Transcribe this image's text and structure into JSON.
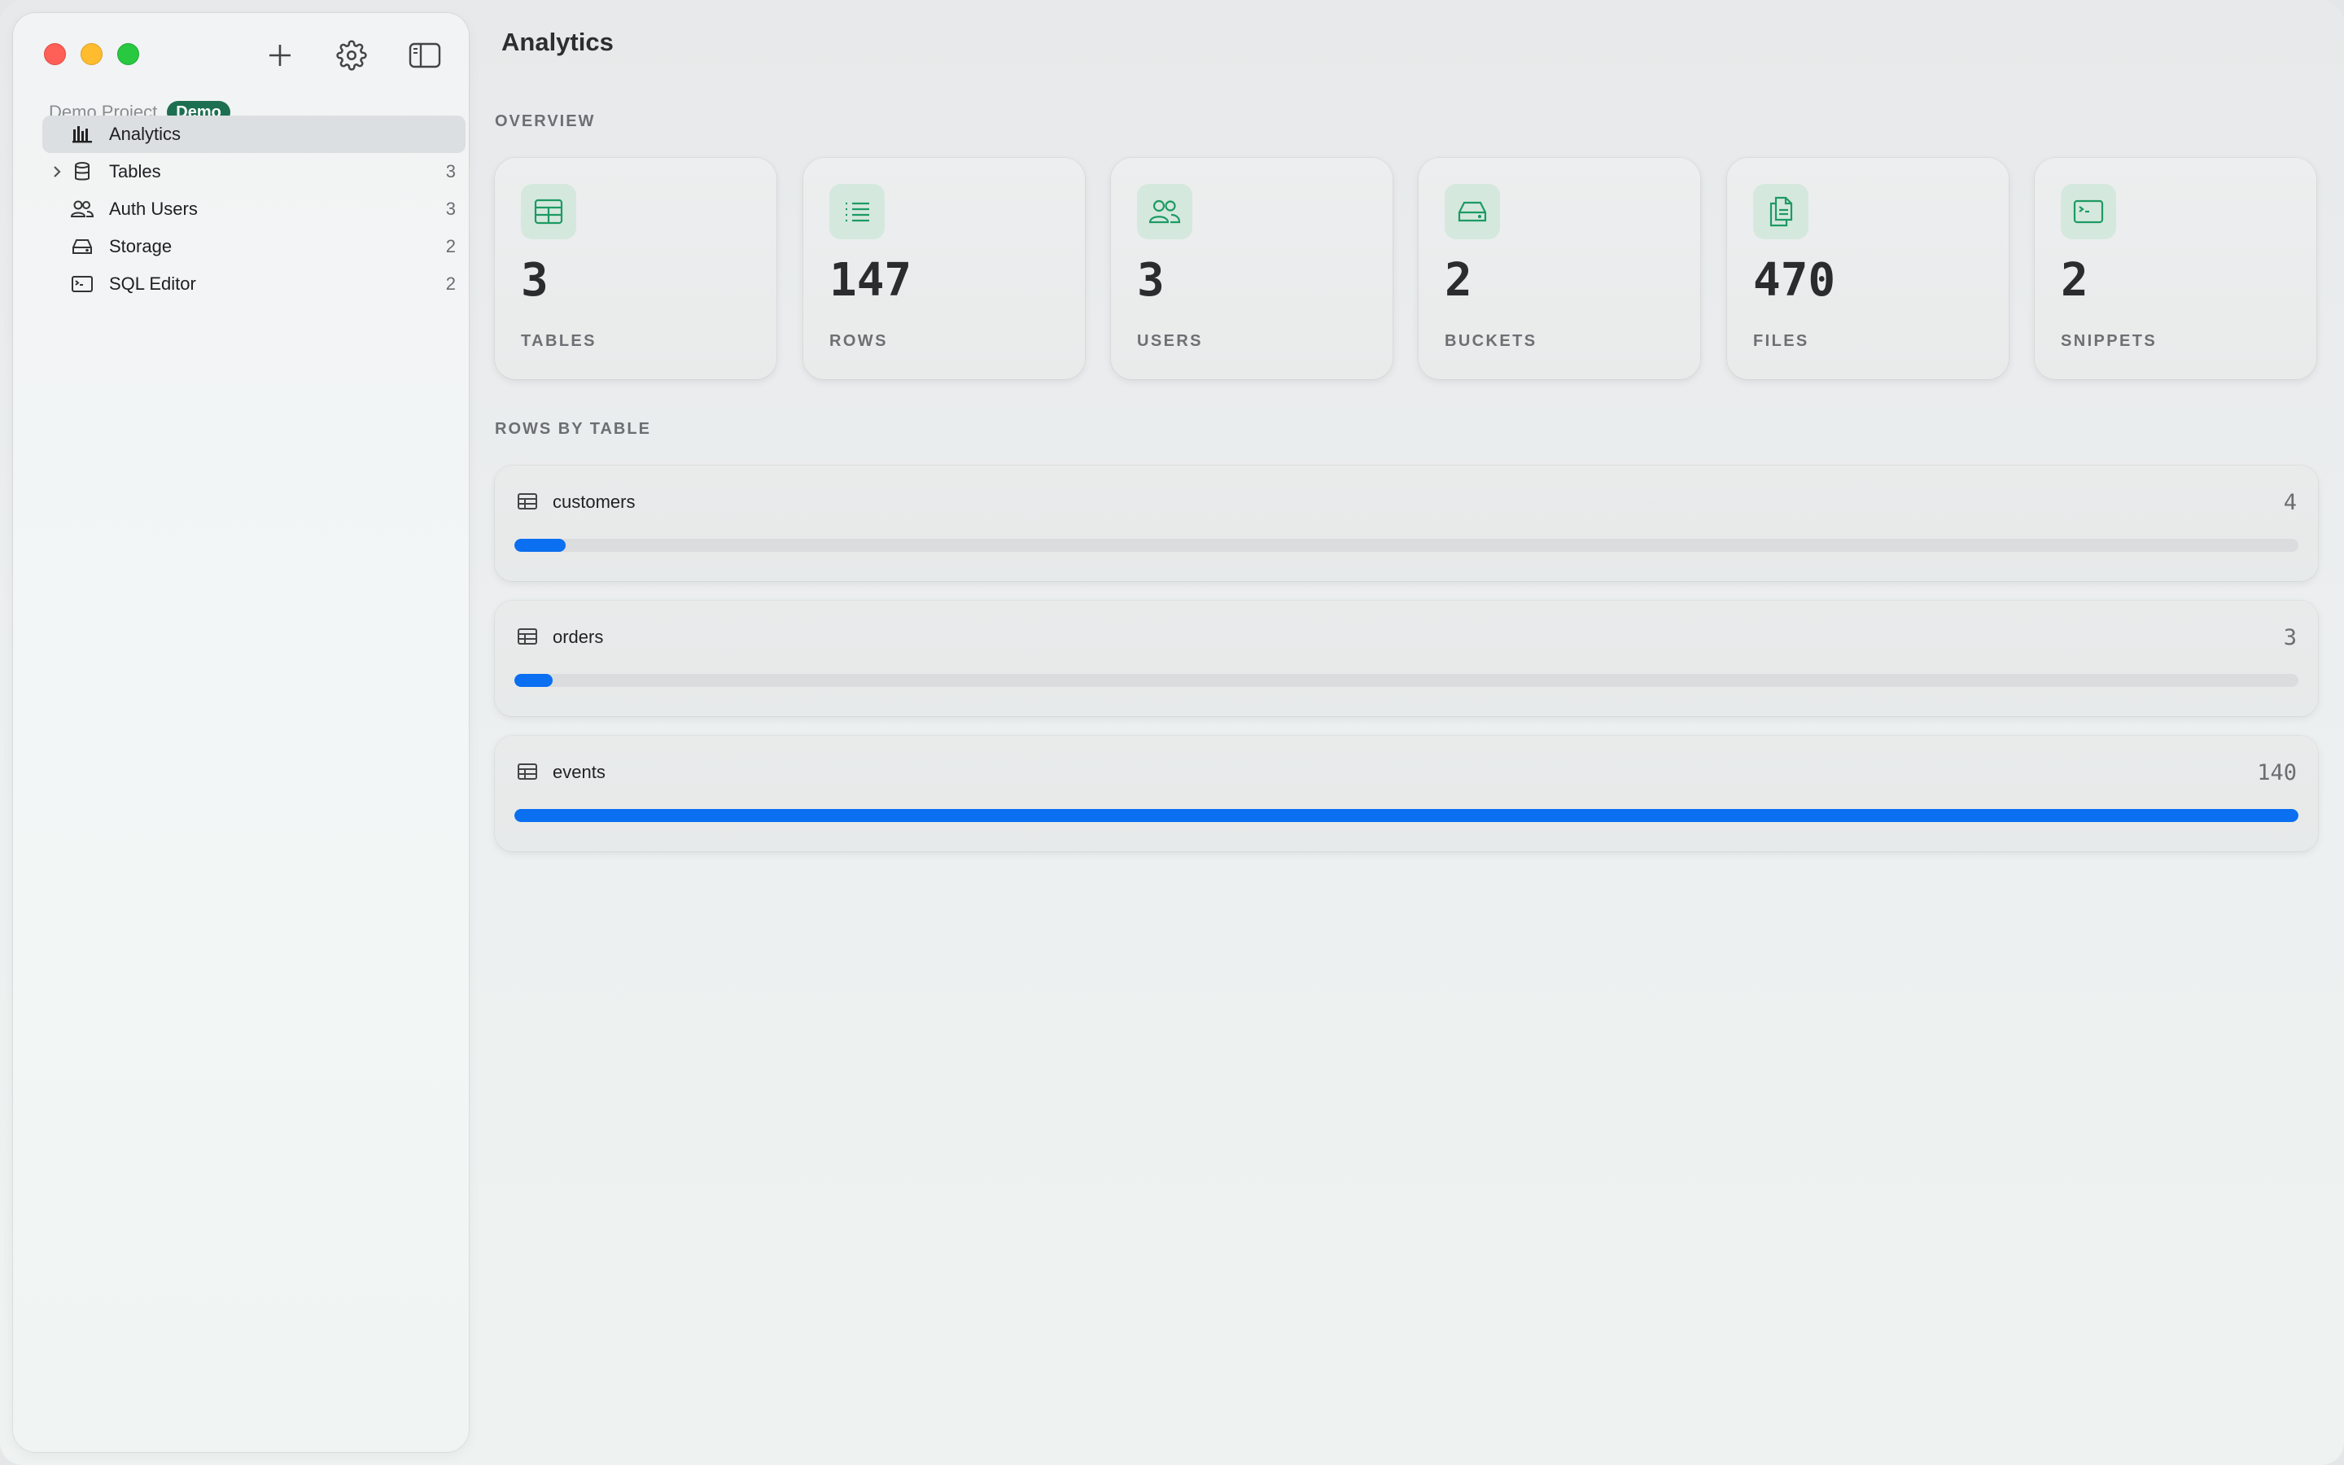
{
  "window": {
    "controls": [
      "close",
      "minimize",
      "zoom"
    ]
  },
  "toolbar": {
    "icons": [
      "plus-icon",
      "gear-icon",
      "sidebar-toggle-icon"
    ]
  },
  "sidebar": {
    "project_name": "Demo Project",
    "project_badge": "Demo",
    "items": [
      {
        "label": "Analytics",
        "count": "",
        "icon": "bar-chart-icon",
        "active": true
      },
      {
        "label": "Tables",
        "count": "3",
        "icon": "database-icon",
        "expandable": true
      },
      {
        "label": "Auth Users",
        "count": "3",
        "icon": "users-icon"
      },
      {
        "label": "Storage",
        "count": "2",
        "icon": "drive-icon"
      },
      {
        "label": "SQL Editor",
        "count": "2",
        "icon": "terminal-icon"
      }
    ]
  },
  "main": {
    "title": "Analytics",
    "overview_label": "OVERVIEW",
    "stats": [
      {
        "value": "3",
        "label": "TABLES",
        "icon": "table-icon"
      },
      {
        "value": "147",
        "label": "ROWS",
        "icon": "list-icon"
      },
      {
        "value": "3",
        "label": "USERS",
        "icon": "users-icon"
      },
      {
        "value": "2",
        "label": "BUCKETS",
        "icon": "drive-icon"
      },
      {
        "value": "470",
        "label": "FILES",
        "icon": "files-icon"
      },
      {
        "value": "2",
        "label": "SNIPPETS",
        "icon": "terminal-icon"
      }
    ],
    "rows_by_table_label": "ROWS BY TABLE",
    "rows_by_table": [
      {
        "name": "customers",
        "count": "4",
        "fraction": 0.0286
      },
      {
        "name": "orders",
        "count": "3",
        "fraction": 0.0214
      },
      {
        "name": "events",
        "count": "140",
        "fraction": 1.0
      }
    ]
  },
  "colors": {
    "accent_green": "#1c9a63",
    "badge_green": "#1d6f52",
    "bar_blue": "#0a6ff0"
  }
}
